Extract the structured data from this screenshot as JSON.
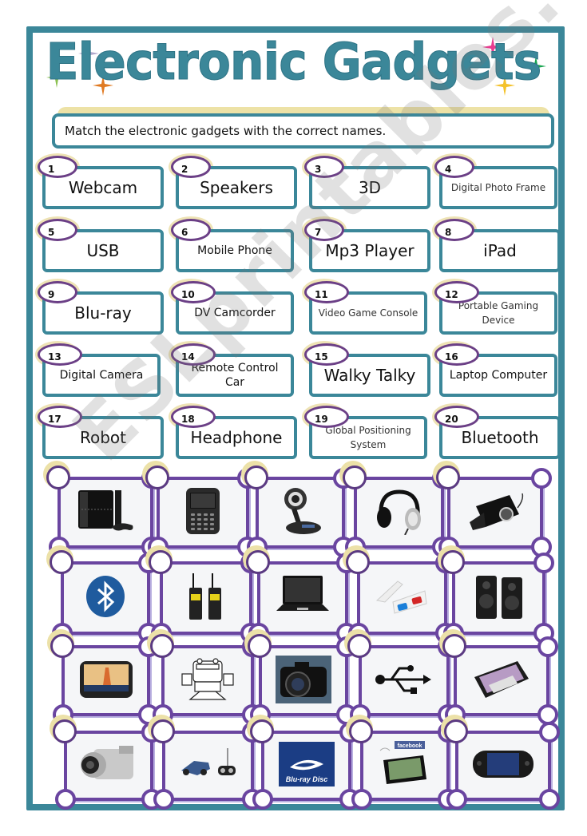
{
  "worksheet": {
    "title": "Electronic Gadgets",
    "instruction": "Match the electronic gadgets with the correct names.",
    "watermark": "ESLprintables.com",
    "colors": {
      "frame": "#3b8799",
      "title": "#3b8799",
      "label_border": "#3b8799",
      "number_circle": "#6b3f86",
      "card_border": "#6a45a0",
      "glow": "#ece1a8"
    }
  },
  "labels": [
    {
      "number": "1",
      "text": "Webcam"
    },
    {
      "number": "2",
      "text": "Speakers"
    },
    {
      "number": "3",
      "text": "3D"
    },
    {
      "number": "4",
      "text": "Digital Photo Frame"
    },
    {
      "number": "5",
      "text": "USB"
    },
    {
      "number": "6",
      "text": "Mobile Phone"
    },
    {
      "number": "7",
      "text": "Mp3 Player"
    },
    {
      "number": "8",
      "text": "iPad"
    },
    {
      "number": "9",
      "text": "Blu-ray"
    },
    {
      "number": "10",
      "text": "DV Camcorder"
    },
    {
      "number": "11",
      "text": "Video Game Console"
    },
    {
      "number": "12",
      "text": "Portable Gaming Device"
    },
    {
      "number": "13",
      "text": "Digital Camera"
    },
    {
      "number": "14",
      "text": "Remote Control Car"
    },
    {
      "number": "15",
      "text": "Walky Talky"
    },
    {
      "number": "16",
      "text": "Laptop Computer"
    },
    {
      "number": "17",
      "text": "Robot"
    },
    {
      "number": "18",
      "text": "Headphone"
    },
    {
      "number": "19",
      "text": "Global Positioning System"
    },
    {
      "number": "20",
      "text": "Bluetooth"
    }
  ],
  "pictures": [
    {
      "icon": "game-console-icon",
      "answer": ""
    },
    {
      "icon": "mobile-phone-icon",
      "answer": ""
    },
    {
      "icon": "webcam-icon",
      "answer": ""
    },
    {
      "icon": "headphone-icon",
      "answer": ""
    },
    {
      "icon": "mp3-player-icon",
      "answer": ""
    },
    {
      "icon": "bluetooth-icon",
      "answer": ""
    },
    {
      "icon": "walky-talky-icon",
      "answer": ""
    },
    {
      "icon": "laptop-icon",
      "answer": ""
    },
    {
      "icon": "3d-glasses-icon",
      "answer": ""
    },
    {
      "icon": "speakers-icon",
      "answer": ""
    },
    {
      "icon": "gps-icon",
      "answer": ""
    },
    {
      "icon": "robot-icon",
      "answer": ""
    },
    {
      "icon": "digital-camera-icon",
      "answer": ""
    },
    {
      "icon": "usb-icon",
      "answer": ""
    },
    {
      "icon": "ipad-icon",
      "answer": ""
    },
    {
      "icon": "camcorder-icon",
      "answer": ""
    },
    {
      "icon": "remote-control-car-icon",
      "answer": ""
    },
    {
      "icon": "blu-ray-icon",
      "answer": ""
    },
    {
      "icon": "digital-photo-frame-icon",
      "answer": ""
    },
    {
      "icon": "portable-gaming-device-icon",
      "answer": ""
    }
  ],
  "picture_text": {
    "bluray_logo": "Blu-ray Disc",
    "facebook_badge": "facebook"
  }
}
